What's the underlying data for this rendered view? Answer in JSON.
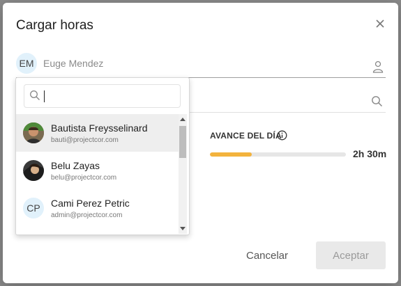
{
  "dialog": {
    "title": "Cargar horas",
    "close_icon": "close-icon"
  },
  "user_field": {
    "initials": "EM",
    "name": "Euge Mendez",
    "icon": "person-icon"
  },
  "search": {
    "placeholder": "",
    "value": "",
    "icon": "search-icon"
  },
  "users": [
    {
      "name": "Bautista Freysselinard",
      "email": "bauti@projectcor.com",
      "avatar": "photo",
      "selected": true
    },
    {
      "name": "Belu Zayas",
      "email": "belu@projectcor.com",
      "avatar": "photo",
      "selected": false
    },
    {
      "name": "Cami Perez Petric",
      "email": "admin@projectcor.com",
      "initials": "CP",
      "avatar": "initials",
      "selected": false
    }
  ],
  "progress": {
    "title": "AVANCE DEL DÍA",
    "value_label": "2h 30m",
    "fraction": 0.31,
    "color": "#f3b33d",
    "info_icon": "info-icon"
  },
  "buttons": {
    "cancel": "Cancelar",
    "accept": "Aceptar"
  }
}
